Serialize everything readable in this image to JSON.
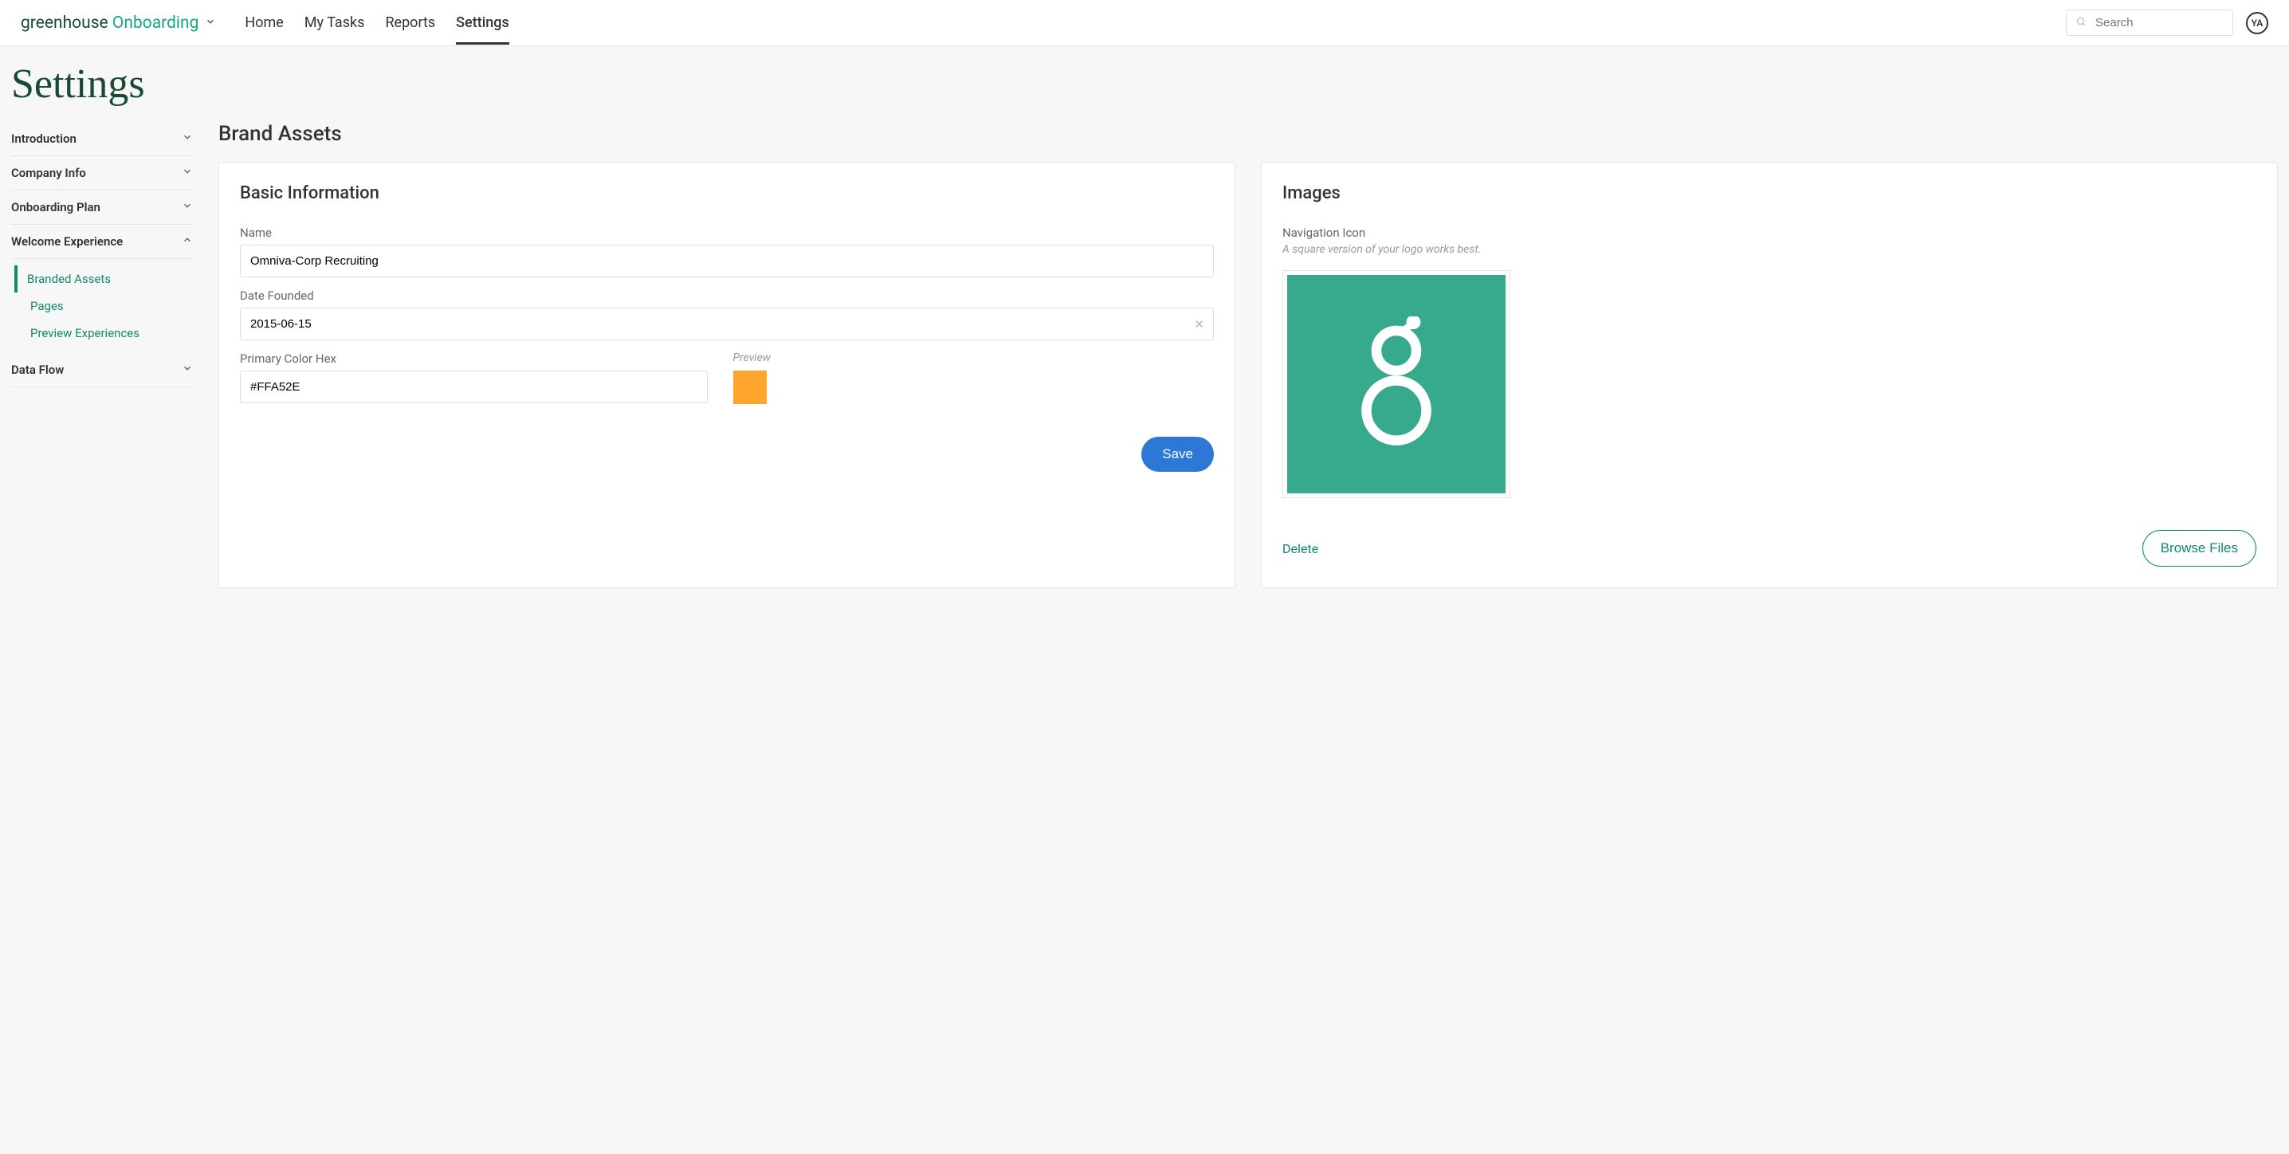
{
  "brand": {
    "first": "greenhouse",
    "second": "Onboarding"
  },
  "nav": {
    "home": "Home",
    "my_tasks": "My Tasks",
    "reports": "Reports",
    "settings": "Settings"
  },
  "search": {
    "placeholder": "Search"
  },
  "avatar": "YA",
  "page": {
    "title": "Settings"
  },
  "sidebar": {
    "introduction": "Introduction",
    "company_info": "Company Info",
    "onboarding_plan": "Onboarding Plan",
    "welcome_experience": "Welcome Experience",
    "branded_assets": "Branded Assets",
    "pages": "Pages",
    "preview": "Preview Experiences",
    "data_flow": "Data Flow"
  },
  "main": {
    "heading": "Brand Assets",
    "basic_info": {
      "title": "Basic Information",
      "name_label": "Name",
      "name_value": "Omniva-Corp Recruiting",
      "date_label": "Date Founded",
      "date_value": "2015-06-15",
      "color_label": "Primary Color Hex",
      "color_value": "#FFA52E",
      "preview_label": "Preview",
      "save_label": "Save"
    },
    "images": {
      "title": "Images",
      "nav_icon_label": "Navigation Icon",
      "hint": "A square version of your logo works best.",
      "delete_label": "Delete",
      "browse_label": "Browse Files"
    }
  },
  "colors": {
    "primary_swatch": "#FFA52E",
    "logo_bg": "#37a98d"
  }
}
